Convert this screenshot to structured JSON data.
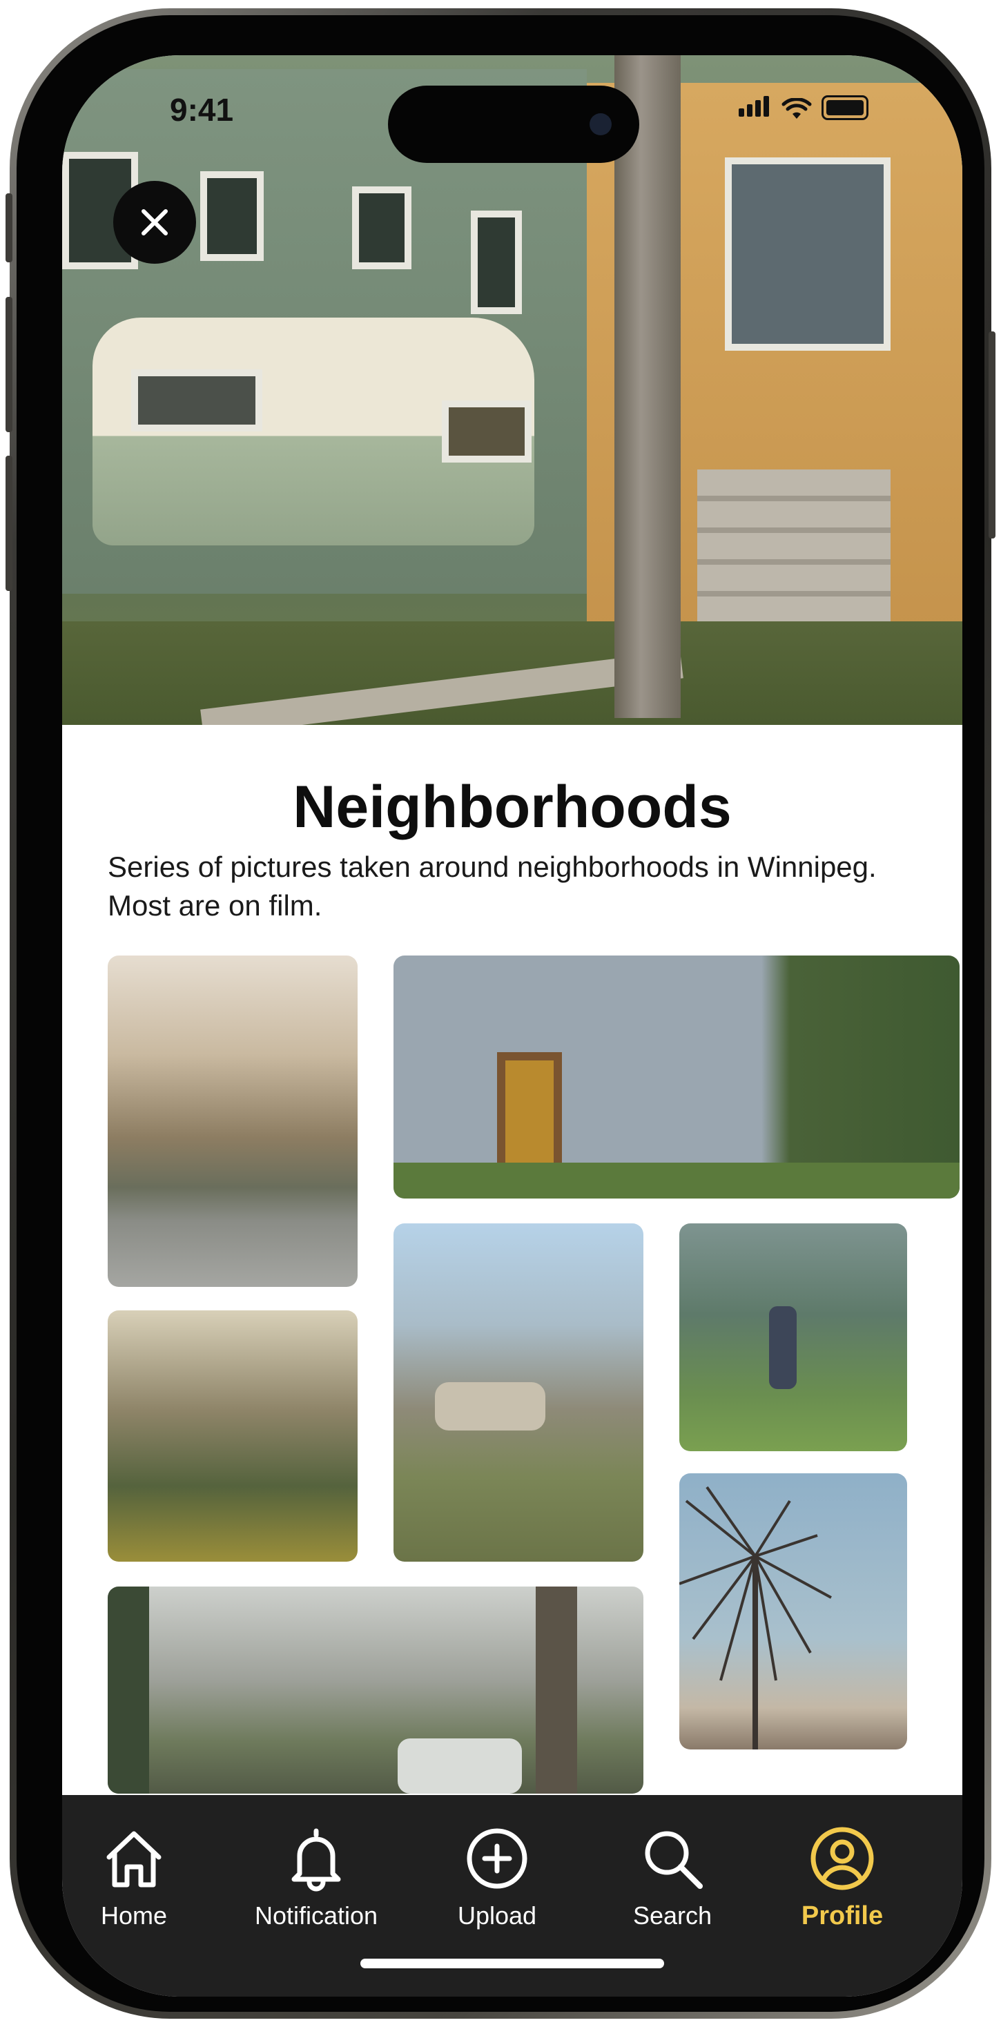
{
  "status_bar": {
    "time": "9:41"
  },
  "album": {
    "title": "Neighborhoods",
    "description": "Series of pictures taken around neighborhoods in Winnipeg. Most are on film."
  },
  "tab_bar": {
    "items": [
      {
        "label": "Home",
        "icon": "home-icon"
      },
      {
        "label": "Notification",
        "icon": "bell-icon"
      },
      {
        "label": "Upload",
        "icon": "plus-circle-icon"
      },
      {
        "label": "Search",
        "icon": "search-icon"
      },
      {
        "label": "Profile",
        "icon": "user-circle-icon"
      }
    ],
    "active": "Profile"
  },
  "colors": {
    "accent": "#F2C94C",
    "tabbar_bg": "#202020"
  }
}
